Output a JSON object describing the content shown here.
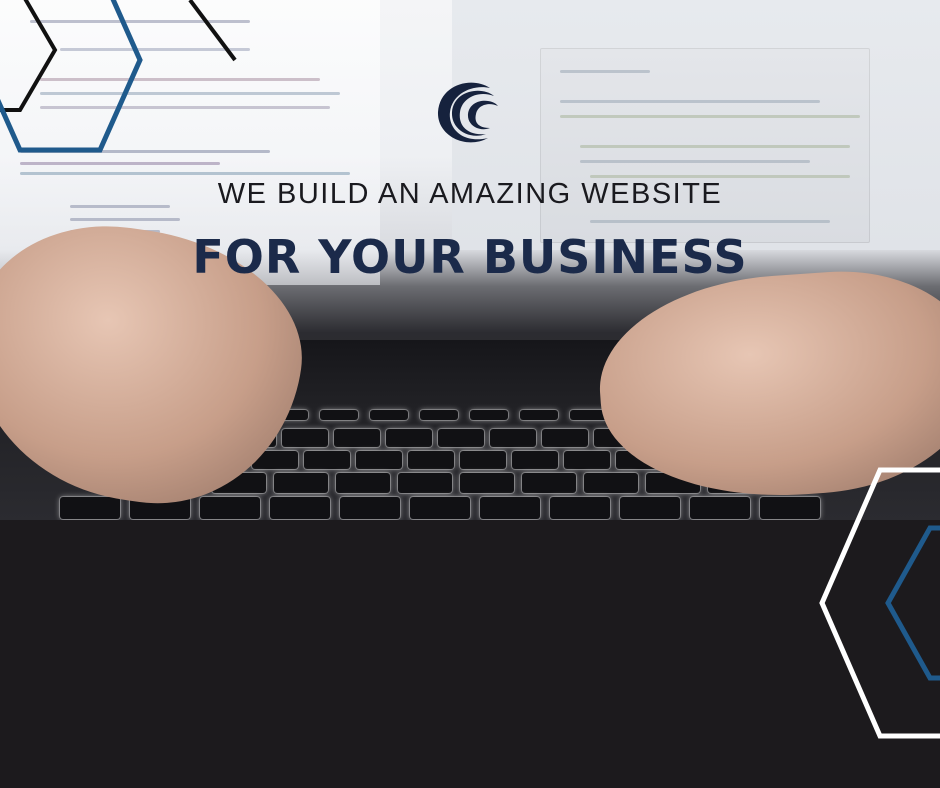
{
  "banner": {
    "tagline": "WE BUILD AN AMAZING WEBSITE",
    "headline": "FOR YOUR BUSINESS"
  },
  "logo": {
    "icon": "crescent-logo-icon"
  },
  "colors": {
    "headline": "#1b2a4a",
    "tagline": "#1a1a1f",
    "hex_blue": "#1f5a8c",
    "hex_white": "#ffffff",
    "hex_black": "#111111",
    "dark_panel": "#1c1a1d"
  }
}
